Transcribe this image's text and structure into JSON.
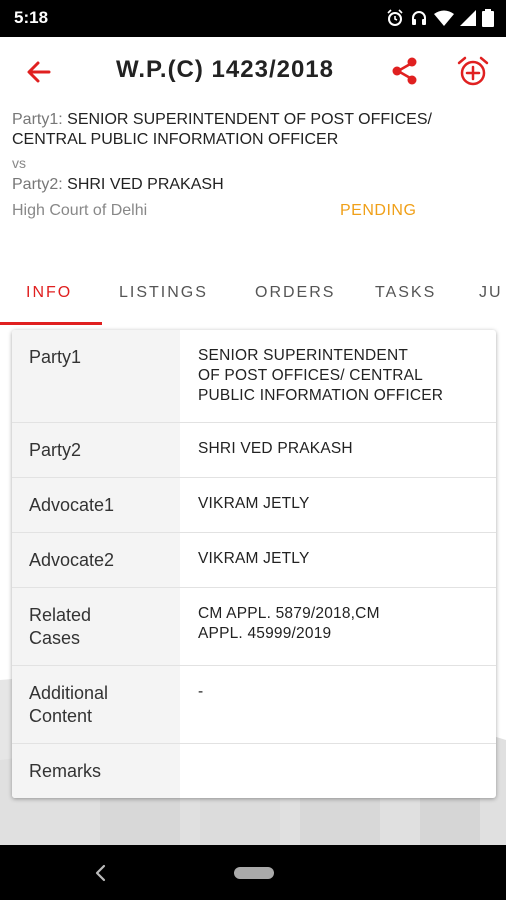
{
  "status_bar": {
    "time": "5:18",
    "icons": [
      "alarm-icon",
      "headset-icon",
      "wifi-icon",
      "signal-icon",
      "battery-icon"
    ]
  },
  "header": {
    "title": "W.P.(C) 1423/2018",
    "back_icon": "arrow-left-icon",
    "share_icon": "share-icon",
    "alarm_icon": "alarm-add-icon",
    "accent_color": "#e02020"
  },
  "summary": {
    "party1_label": "Party1:",
    "party1_value": "SENIOR SUPERINTENDENT OF POST OFFICES/",
    "party1_value_line2": "CENTRAL PUBLIC INFORMATION OFFICER",
    "vs": "vs",
    "party2_label": "Party2:",
    "party2_value": "SHRI VED PRAKASH",
    "court": "High Court of Delhi",
    "status": "PENDING",
    "status_color": "#f0a019"
  },
  "tabs": [
    {
      "label": "INFO",
      "active": true
    },
    {
      "label": "LISTINGS",
      "active": false
    },
    {
      "label": "ORDERS",
      "active": false
    },
    {
      "label": "TASKS",
      "active": false
    },
    {
      "label": "JU",
      "active": false
    }
  ],
  "details": {
    "rows": [
      {
        "label": "Party1",
        "value_lines": [
          "SENIOR SUPERINTENDENT",
          "OF POST OFFICES/ CENTRAL",
          "PUBLIC INFORMATION OFFICER"
        ]
      },
      {
        "label": "Party2",
        "value_lines": [
          "SHRI VED PRAKASH"
        ]
      },
      {
        "label": "Advocate1",
        "value_lines": [
          "VIKRAM JETLY"
        ]
      },
      {
        "label": "Advocate2",
        "value_lines": [
          "VIKRAM JETLY"
        ]
      },
      {
        "label_lines": [
          "Related",
          "Cases"
        ],
        "value_lines": [
          "CM APPL. 5879/2018,CM",
          "APPL. 45999/2019"
        ]
      },
      {
        "label_lines": [
          "Additional",
          "Content"
        ],
        "value_lines": [
          "-"
        ]
      },
      {
        "label": "Remarks",
        "value_lines": [
          ""
        ]
      }
    ]
  },
  "nav_bar": {
    "back_icon": "nav-back-icon",
    "home_icon": "nav-home-pill"
  }
}
